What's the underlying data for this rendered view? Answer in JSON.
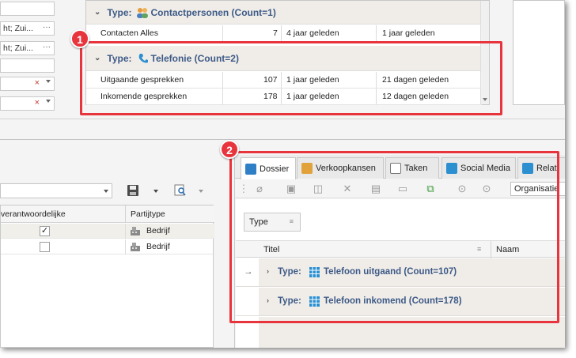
{
  "left_fields": [
    {
      "value": ""
    },
    {
      "value": "ht; Zui..."
    },
    {
      "value": "ht; Zui..."
    },
    {
      "value": ""
    },
    {
      "value": ""
    },
    {
      "value": ""
    }
  ],
  "top_grid": {
    "groups": [
      {
        "type_label": "Type:",
        "name": "Contactpersonen (Count=1)"
      },
      {
        "type_label": "Type:",
        "name": "Telefonie (Count=2)"
      }
    ],
    "rows": [
      {
        "name": "Contacten Alles",
        "count": "7",
        "first": "4 jaar geleden",
        "last": "1 jaar geleden"
      },
      {
        "name": "Uitgaande gesprekken",
        "count": "107",
        "first": "1 jaar geleden",
        "last": "21 dagen geleden"
      },
      {
        "name": "Inkomende gesprekken",
        "count": "178",
        "first": "1 jaar geleden",
        "last": "12 dagen geleden"
      }
    ]
  },
  "callouts": {
    "one": "1",
    "two": "2"
  },
  "left_grid": {
    "headers": [
      "verantwoordelijke",
      "Partijtype"
    ],
    "rows": [
      {
        "checked": "✓",
        "type": "Bedrijf"
      },
      {
        "checked": "",
        "type": "Bedrijf"
      }
    ]
  },
  "tabs": [
    "Dossier",
    "Verkoopkansen",
    "Taken",
    "Social Media",
    "Relat"
  ],
  "org_select": "Organisatie",
  "dossier": {
    "type_button": "Type",
    "columns": [
      "Titel",
      "Naam"
    ],
    "row_indicator": "→",
    "groups": [
      {
        "type_label": "Type:",
        "name": "Telefoon uitgaand (Count=107)"
      },
      {
        "type_label": "Type:",
        "name": "Telefoon inkomend (Count=178)"
      }
    ]
  },
  "colors": {
    "callout": "#e8343c",
    "group_text": "#3d5a86"
  }
}
